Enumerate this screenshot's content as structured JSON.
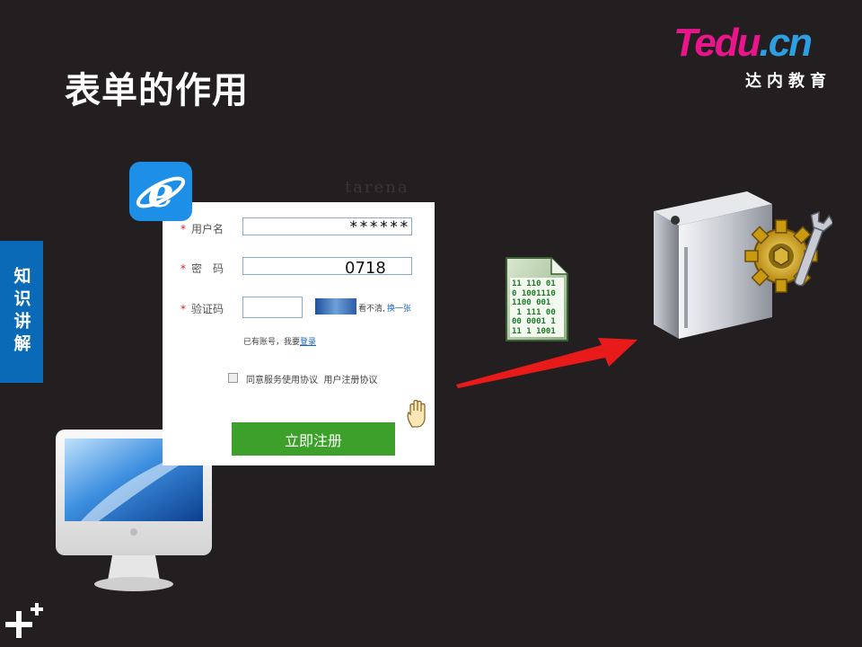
{
  "slide": {
    "title": "表单的作用",
    "side_tab": "知识讲解"
  },
  "logo": {
    "brand_main_1": "Tedu",
    "brand_main_2": ".cn",
    "brand_sub": "达内教育"
  },
  "form": {
    "watermark": "tarena",
    "username_label": "用户名",
    "username_value": "******",
    "password_label": "密　码",
    "password_value": "0718",
    "captcha_label": "验证码",
    "captcha_unclear": "看不清,",
    "captcha_refresh": "换一张",
    "have_account": "已有账号，我要",
    "login_link": "登录",
    "agree_text": "同意服务使用协议",
    "agreement_link": "用户注册协议",
    "submit_label": "立即注册",
    "required_mark": "*"
  },
  "data_file": {
    "binary_lines": "11 110 01\n0 1001110\n1100 001\n 1 111 00\n00 0001 1\n11 1 1001"
  },
  "colors": {
    "background": "#231f20",
    "side_tab": "#0a6ab8",
    "submit_button": "#3ca02a",
    "arrow": "#e81a1a",
    "ie_blue": "#1d8fe6"
  },
  "icons": [
    "ie-browser-icon",
    "desktop-computer-icon",
    "binary-data-file-icon",
    "server-gear-icon",
    "hand-cursor-icon",
    "red-arrow"
  ]
}
